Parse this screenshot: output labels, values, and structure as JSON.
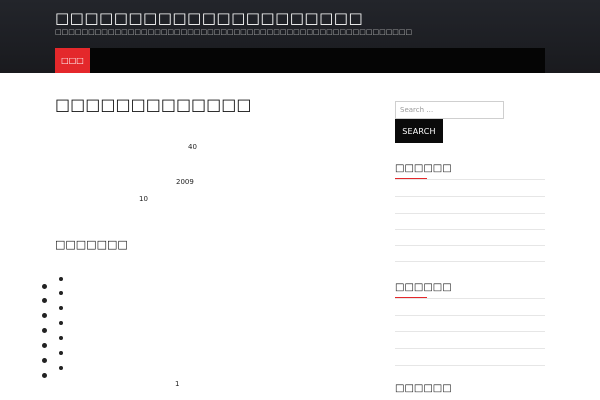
{
  "header": {
    "site_title": "□□□□□□□□□□□□□□□□□□□□□",
    "site_description": "□□□□□□□□□□□□□□□□□□□□□□□□□□□□□□□□□□□□□□□□□□□□□□□□□□□□□□",
    "nav": {
      "home_label": "□□□"
    }
  },
  "article": {
    "title": "□□□□□□□□□□□□□",
    "numbers": {
      "a": "40",
      "b": "2009",
      "c": "10",
      "d": "1"
    },
    "toc_heading": "□□□□□□□"
  },
  "sidebar": {
    "search": {
      "placeholder": "Search …",
      "button_label": "SEARCH"
    },
    "widgets": [
      {
        "title": "□□□□□□"
      },
      {
        "title": "□□□□□□"
      },
      {
        "title": "□□□□□□"
      }
    ]
  },
  "colors": {
    "header_bg": "#1d1e22",
    "nav_bg": "#050505",
    "accent": "#e4282b",
    "button_bg": "#0a0a0a"
  }
}
